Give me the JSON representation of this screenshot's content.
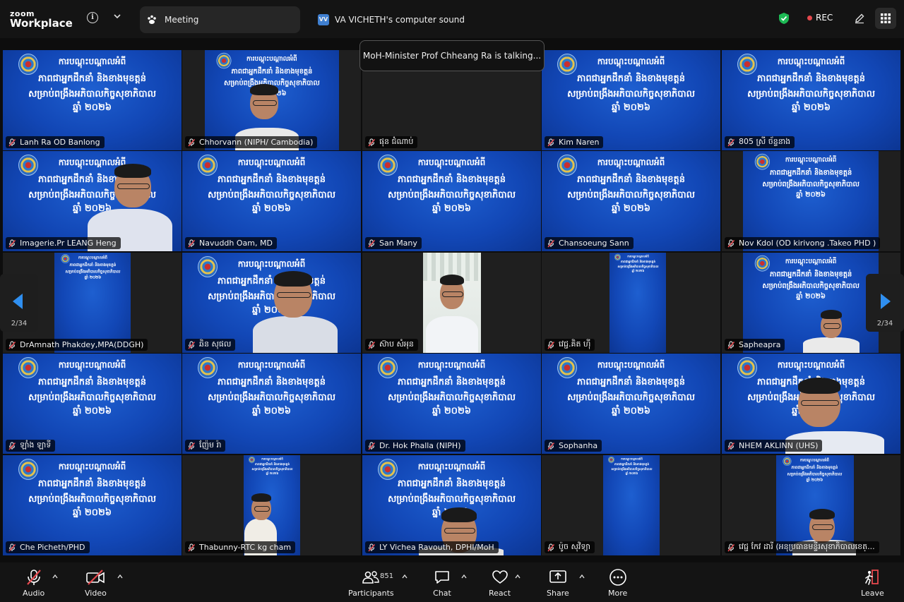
{
  "app": {
    "brand_small": "zoom",
    "brand_large": "Workplace"
  },
  "tabs": [
    {
      "label": "Meeting"
    },
    {
      "badge": "VV",
      "label": "VA VICHETH's computer sound"
    }
  ],
  "recording": {
    "label": "REC"
  },
  "speaker_toast": "MoH-Minister Prof Chheang Ra is talking...",
  "slide_text": [
    "ការបណ្ដុះបណ្ដាលអំពី",
    "ភាពជាអ្នកដឹកនាំ និងខាងមុខត្តន់",
    "សម្រាប់ពង្រឹងអភិបាលកិច្ចសុខាភិបាល",
    "ឆ្នាំ ២០២៦"
  ],
  "participants": [
    "Lanh Ra OD Banlong",
    "Chhorvann (NIPH/ Cambodia)",
    "ផុន ជំណាប់",
    "Kim Naren",
    "805 ស្រី ច័ន្ទនាង",
    "Imagerie.Pr LEANG Heng",
    "Navuddh Oam, MD",
    "San Many",
    "Chansoeung Sann",
    "Nov Kdol (OD kirivong .Takeo PHD )",
    "DrAmnath Phakdey,MPA(DDGH)",
    "ឆិន សុផល",
    "ស៊ាប សំអុន",
    "វេជ្ជ.គិត ហ៊ី",
    "Sapheapra",
    "ឡាំង ឡាទី",
    "ញ៉ែម រ៉ា",
    "Dr. Hok Phalla (NIPH)",
    "Sophanha",
    "NHEM AKLINN (UHS)",
    "Che Picheth/PHD",
    "Thabunny-RTC kg cham",
    "LY Vichea Ravouth, DPHI/MoH",
    "ប៉ូច សុវិទ្យា",
    "វេជ្ជ កែវ ដារី (អនុប្រធានមន្ទីរសុខាភិបាលខេត្..."
  ],
  "pagination": {
    "left": "2/34",
    "right": "2/34"
  },
  "toolbar": {
    "audio": "Audio",
    "video": "Video",
    "participants": "Participants",
    "participant_count": "851",
    "chat": "Chat",
    "react": "React",
    "share": "Share",
    "more": "More",
    "leave": "Leave"
  },
  "colors": {
    "accent_blue": "#2f8ff0",
    "rec_red": "#e5484d",
    "shield_green": "#1db954",
    "mic_off_red": "#e5484d"
  }
}
